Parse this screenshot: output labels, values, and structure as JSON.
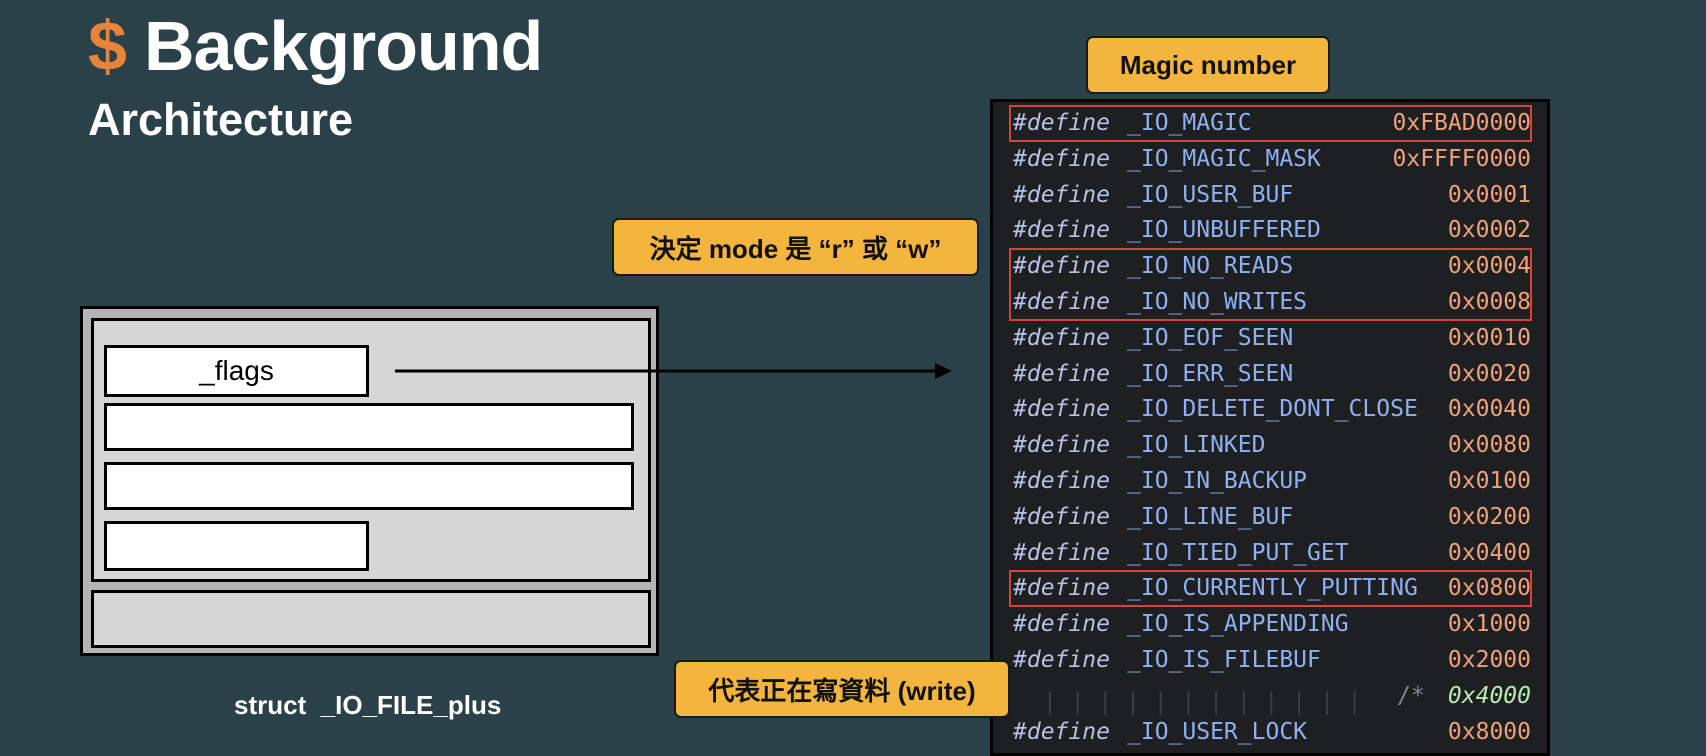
{
  "header": {
    "dollar": "$",
    "title": "Background",
    "subtitle": "Architecture"
  },
  "diagram": {
    "field_label": "_flags",
    "struct_label": "struct  _IO_FILE_plus"
  },
  "callouts": {
    "magic": "Magic number",
    "mode": "決定 mode 是 “r” 或 “w”",
    "write": "代表正在寫資料 (write)"
  },
  "code": {
    "keyword": "#define",
    "comment_prefix": "/*",
    "highlight_color": "#d4443a",
    "lines": [
      {
        "name": "_IO_MAGIC",
        "value": "0xFBAD0000",
        "highlighted": true
      },
      {
        "name": "_IO_MAGIC_MASK",
        "value": "0xFFFF0000",
        "highlighted": false
      },
      {
        "name": "_IO_USER_BUF",
        "value": "0x0001",
        "highlighted": false
      },
      {
        "name": "_IO_UNBUFFERED",
        "value": "0x0002",
        "highlighted": false
      },
      {
        "name": "_IO_NO_READS",
        "value": "0x0004",
        "highlighted": true
      },
      {
        "name": "_IO_NO_WRITES",
        "value": "0x0008",
        "highlighted": true
      },
      {
        "name": "_IO_EOF_SEEN",
        "value": "0x0010",
        "highlighted": false
      },
      {
        "name": "_IO_ERR_SEEN",
        "value": "0x0020",
        "highlighted": false
      },
      {
        "name": "_IO_DELETE_DONT_CLOSE",
        "value": "0x0040",
        "highlighted": false
      },
      {
        "name": "_IO_LINKED",
        "value": "0x0080",
        "highlighted": false
      },
      {
        "name": "_IO_IN_BACKUP",
        "value": "0x0100",
        "highlighted": false
      },
      {
        "name": "_IO_LINE_BUF",
        "value": "0x0200",
        "highlighted": false
      },
      {
        "name": "_IO_TIED_PUT_GET",
        "value": "0x0400",
        "highlighted": false
      },
      {
        "name": "_IO_CURRENTLY_PUTTING",
        "value": "0x0800",
        "highlighted": true
      },
      {
        "name": "_IO_IS_APPENDING",
        "value": "0x1000",
        "highlighted": false
      },
      {
        "name": "_IO_IS_FILEBUF",
        "value": "0x2000",
        "highlighted": false
      },
      {
        "name": "",
        "value": "0x4000",
        "highlighted": false
      },
      {
        "name": "_IO_USER_LOCK",
        "value": "0x8000",
        "highlighted": false
      }
    ]
  }
}
